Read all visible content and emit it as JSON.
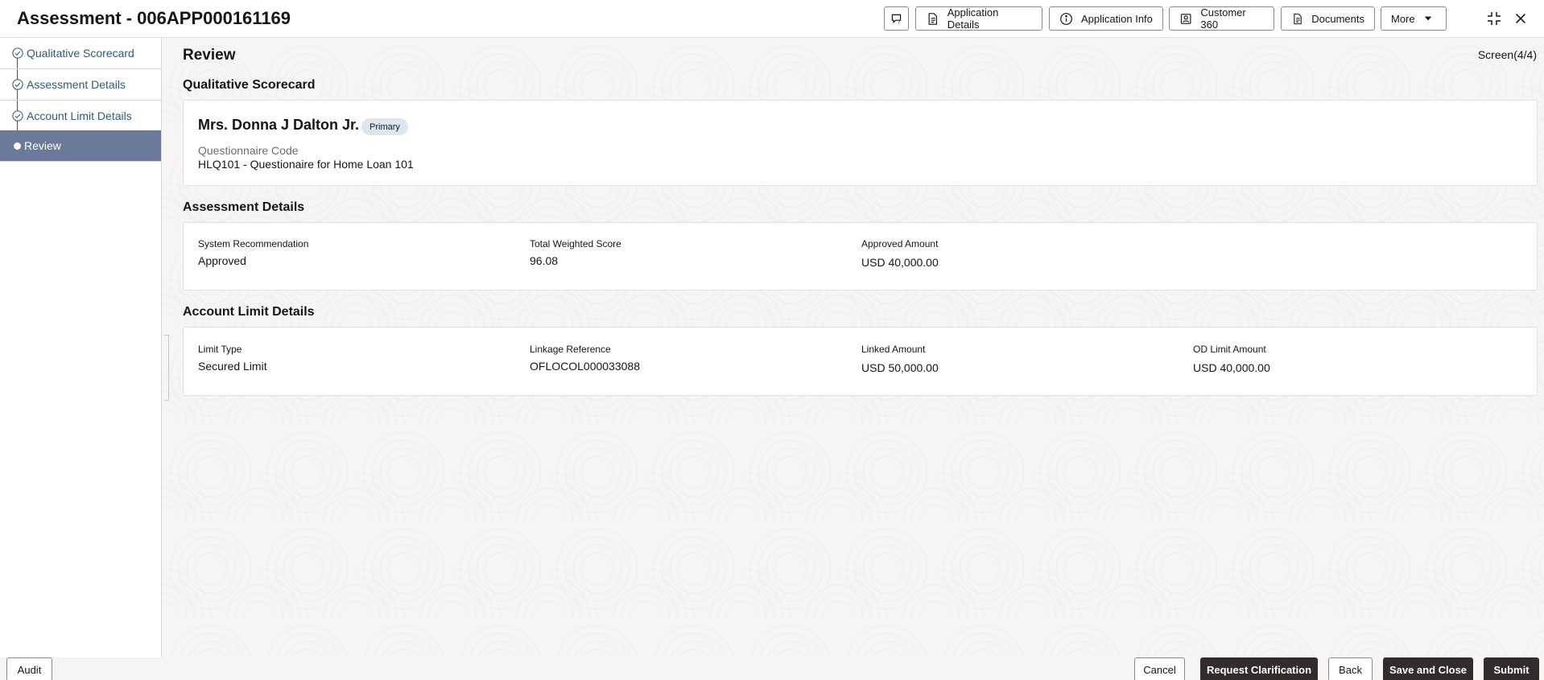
{
  "header": {
    "title": "Assessment - 006APP000161169",
    "buttons": {
      "application_details": "Application Details",
      "application_info": "Application Info",
      "customer_360": "Customer 360",
      "documents": "Documents",
      "more": "More"
    }
  },
  "sidebar": {
    "steps": [
      {
        "label": "Qualitative Scorecard",
        "state": "completed"
      },
      {
        "label": "Assessment Details",
        "state": "completed"
      },
      {
        "label": "Account Limit Details",
        "state": "completed"
      },
      {
        "label": "Review",
        "state": "active"
      }
    ],
    "audit_label": "Audit"
  },
  "main": {
    "page_title": "Review",
    "screen_count": "Screen(4/4)",
    "qualitative": {
      "section_title": "Qualitative Scorecard",
      "person_name": "Mrs. Donna J Dalton Jr.",
      "badge": "Primary",
      "questionnaire_label": "Questionnaire Code",
      "questionnaire_value": "HLQ101 - Questionaire for Home Loan 101"
    },
    "assessment": {
      "section_title": "Assessment Details",
      "fields": [
        {
          "label": "System Recommendation",
          "value": "Approved"
        },
        {
          "label": "Total Weighted Score",
          "value": "96.08"
        },
        {
          "label": "Approved Amount",
          "value": "USD 40,000.00"
        }
      ]
    },
    "account_limit": {
      "section_title": "Account Limit Details",
      "fields": [
        {
          "label": "Limit Type",
          "value": "Secured Limit"
        },
        {
          "label": "Linkage Reference",
          "value": "OFLOCOL000033088"
        },
        {
          "label": "Linked Amount",
          "value": "USD 50,000.00"
        },
        {
          "label": "OD Limit Amount",
          "value": "USD 40,000.00"
        }
      ]
    }
  },
  "footer": {
    "cancel": "Cancel",
    "request_clarification": "Request Clarification",
    "back": "Back",
    "save_and_close": "Save and Close",
    "submit": "Submit"
  },
  "colors": {
    "active_step": "#6b7a99",
    "link_text": "#2f5a7a",
    "dark_button": "#312d2a"
  }
}
